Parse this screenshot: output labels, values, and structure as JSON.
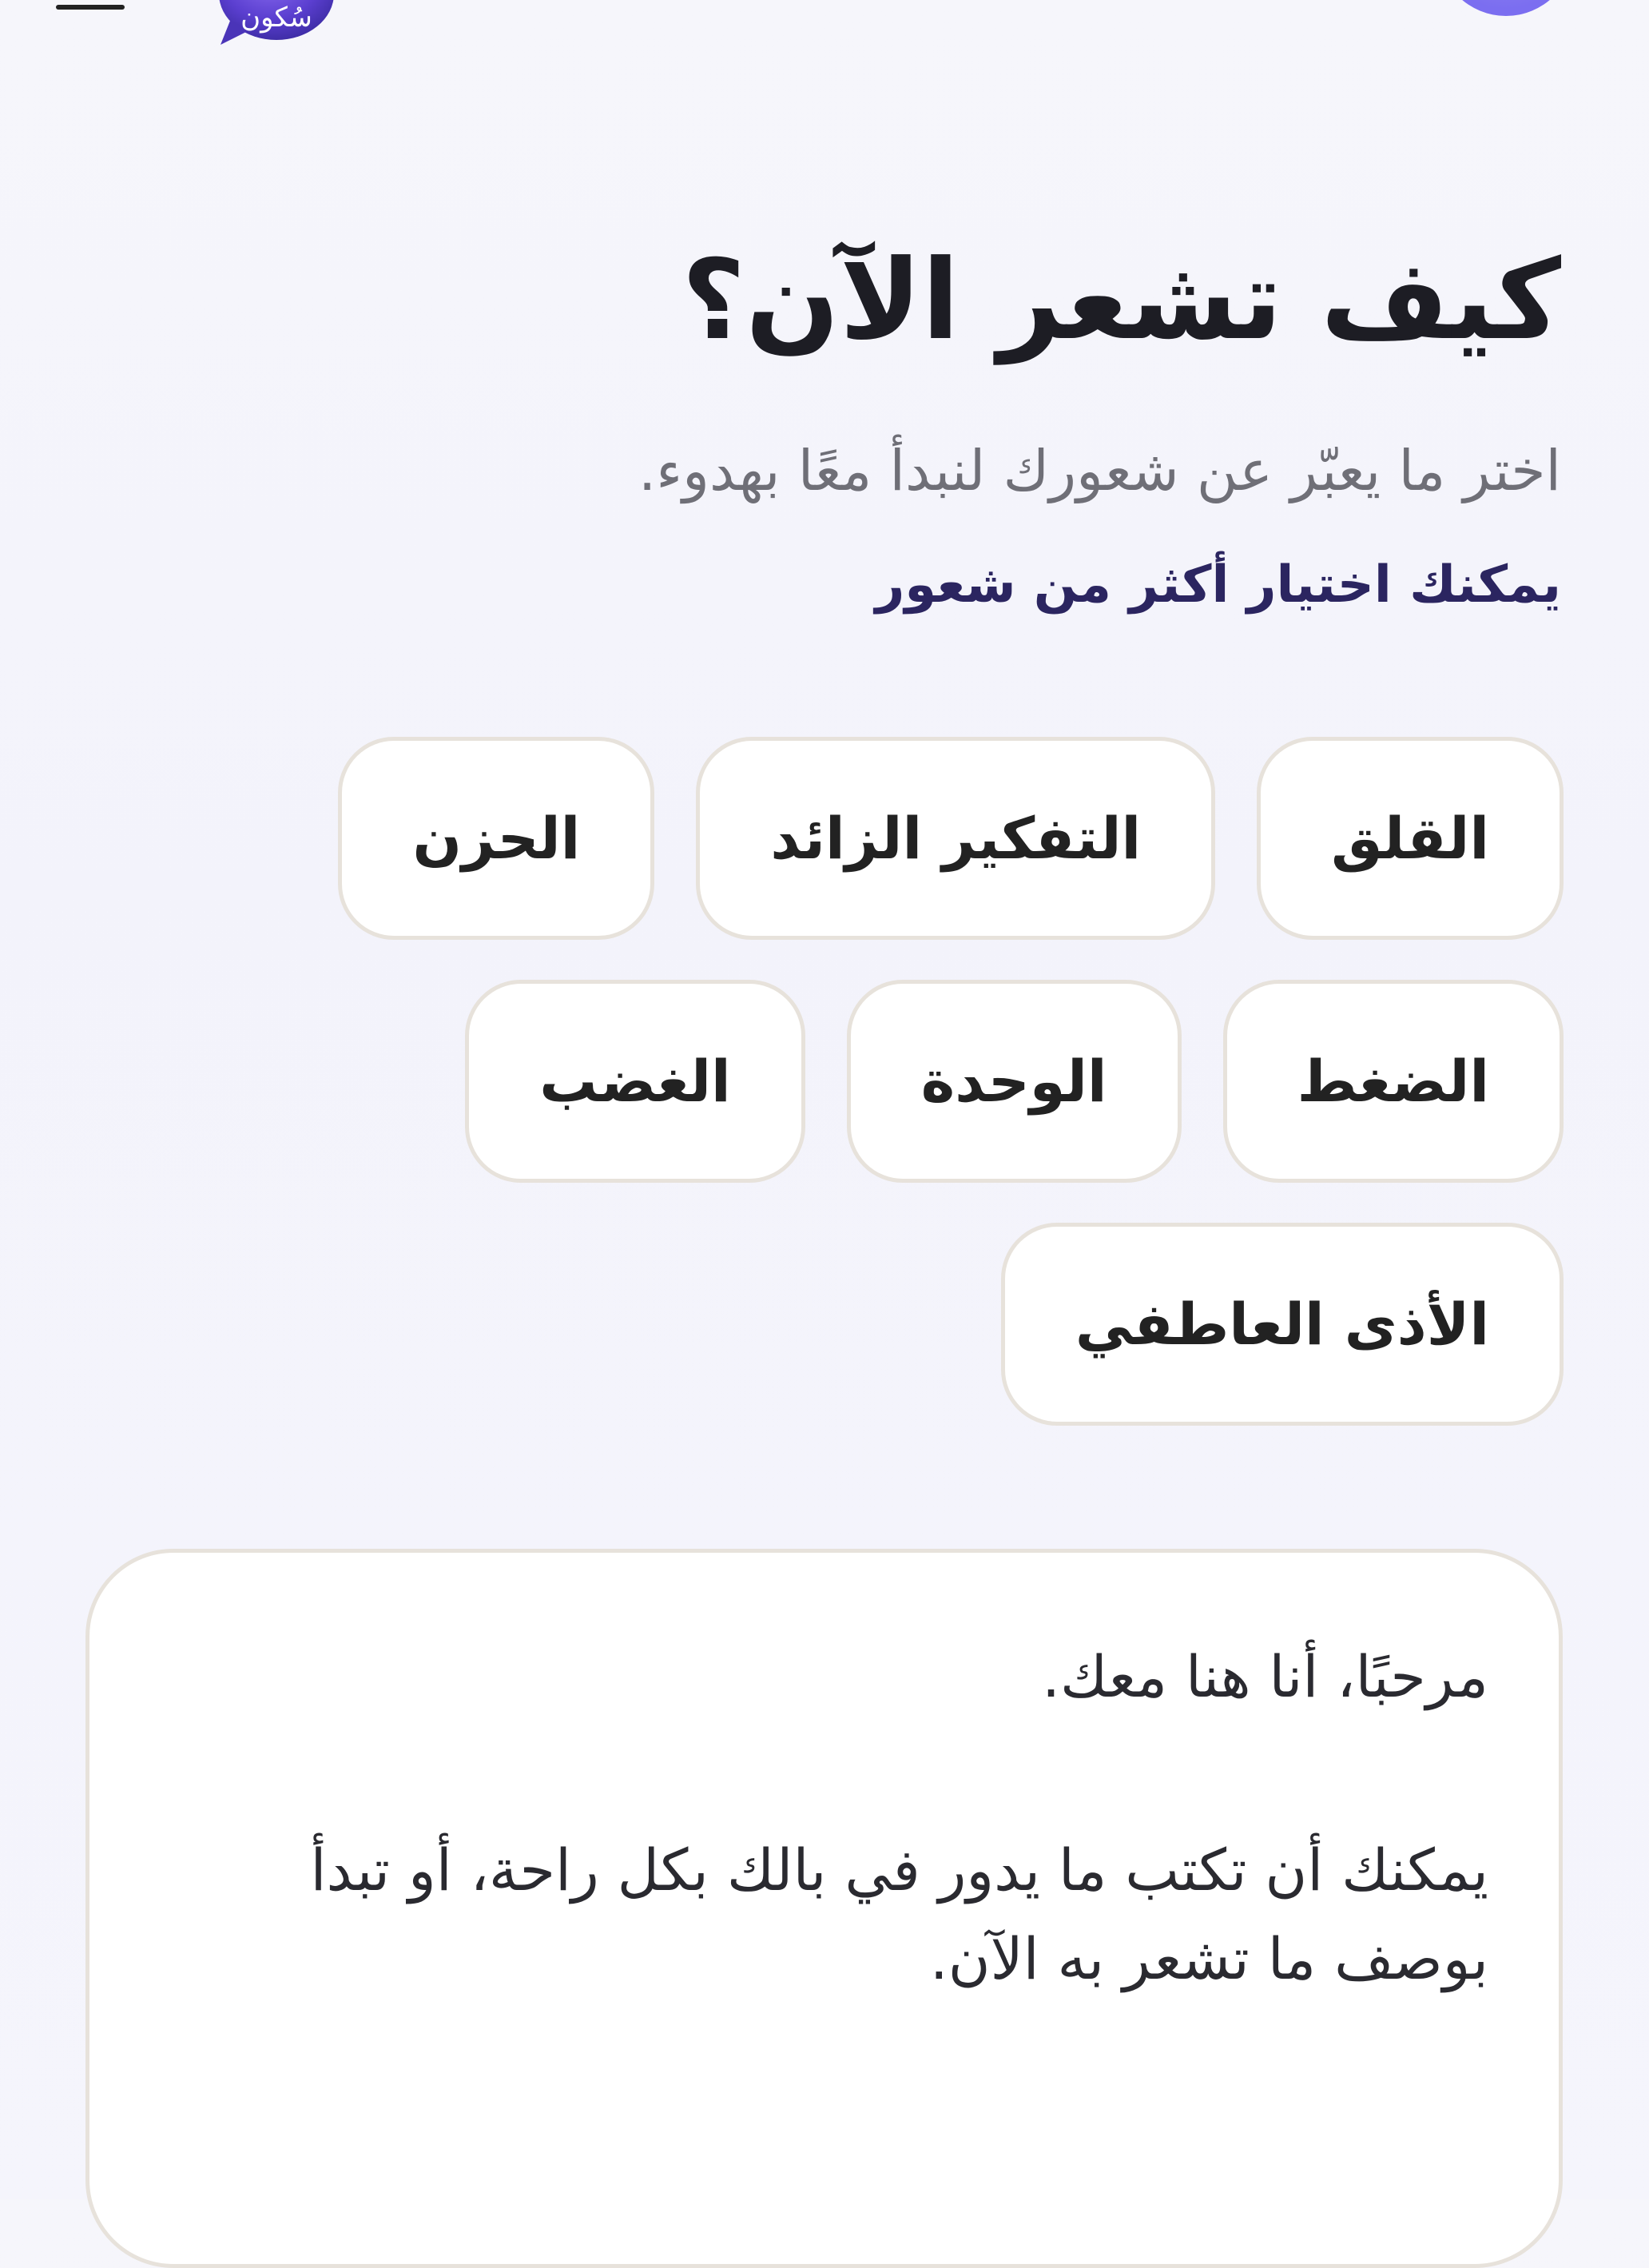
{
  "header": {
    "logo_text": "سُكون",
    "menu_icon": "hamburger-icon",
    "brand_color": "#5b4fd6",
    "accent_color": "#7b6ef0"
  },
  "main": {
    "title": "كيف تشعر الآن؟",
    "subtitle": "اختر ما يعبّر عن شعورك لنبدأ معًا بهدوء.",
    "multi_select_hint": "يمكنك اختيار أكثر من شعور",
    "feelings": [
      "القلق",
      "التفكير الزائد",
      "الحزن",
      "الضغط",
      "الوحدة",
      "الغضب",
      "الأذى العاطفي"
    ]
  },
  "message_card": {
    "greeting": "مرحبًا، أنا هنا معك.",
    "body": "يمكنك أن تكتب ما يدور في بالك بكل راحة، أو تبدأ بوصف ما تشعر به الآن."
  }
}
